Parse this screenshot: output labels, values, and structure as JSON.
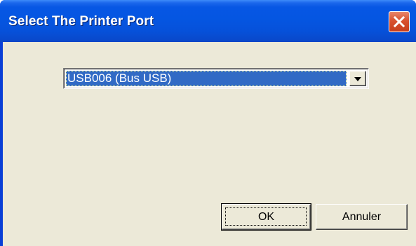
{
  "window": {
    "title": "Select The Printer Port"
  },
  "titlebar": {
    "close_icon": "close-icon",
    "accent": "#0556e2",
    "close_color": "#d8512f"
  },
  "port_select": {
    "selected_value": "USB006 (Bus USB)",
    "dropdown_icon": "chevron-down-icon",
    "highlight_color": "#316ac5"
  },
  "buttons": {
    "ok_label": "OK",
    "cancel_label": "Annuler"
  },
  "colors": {
    "client_bg": "#ece9d8"
  }
}
